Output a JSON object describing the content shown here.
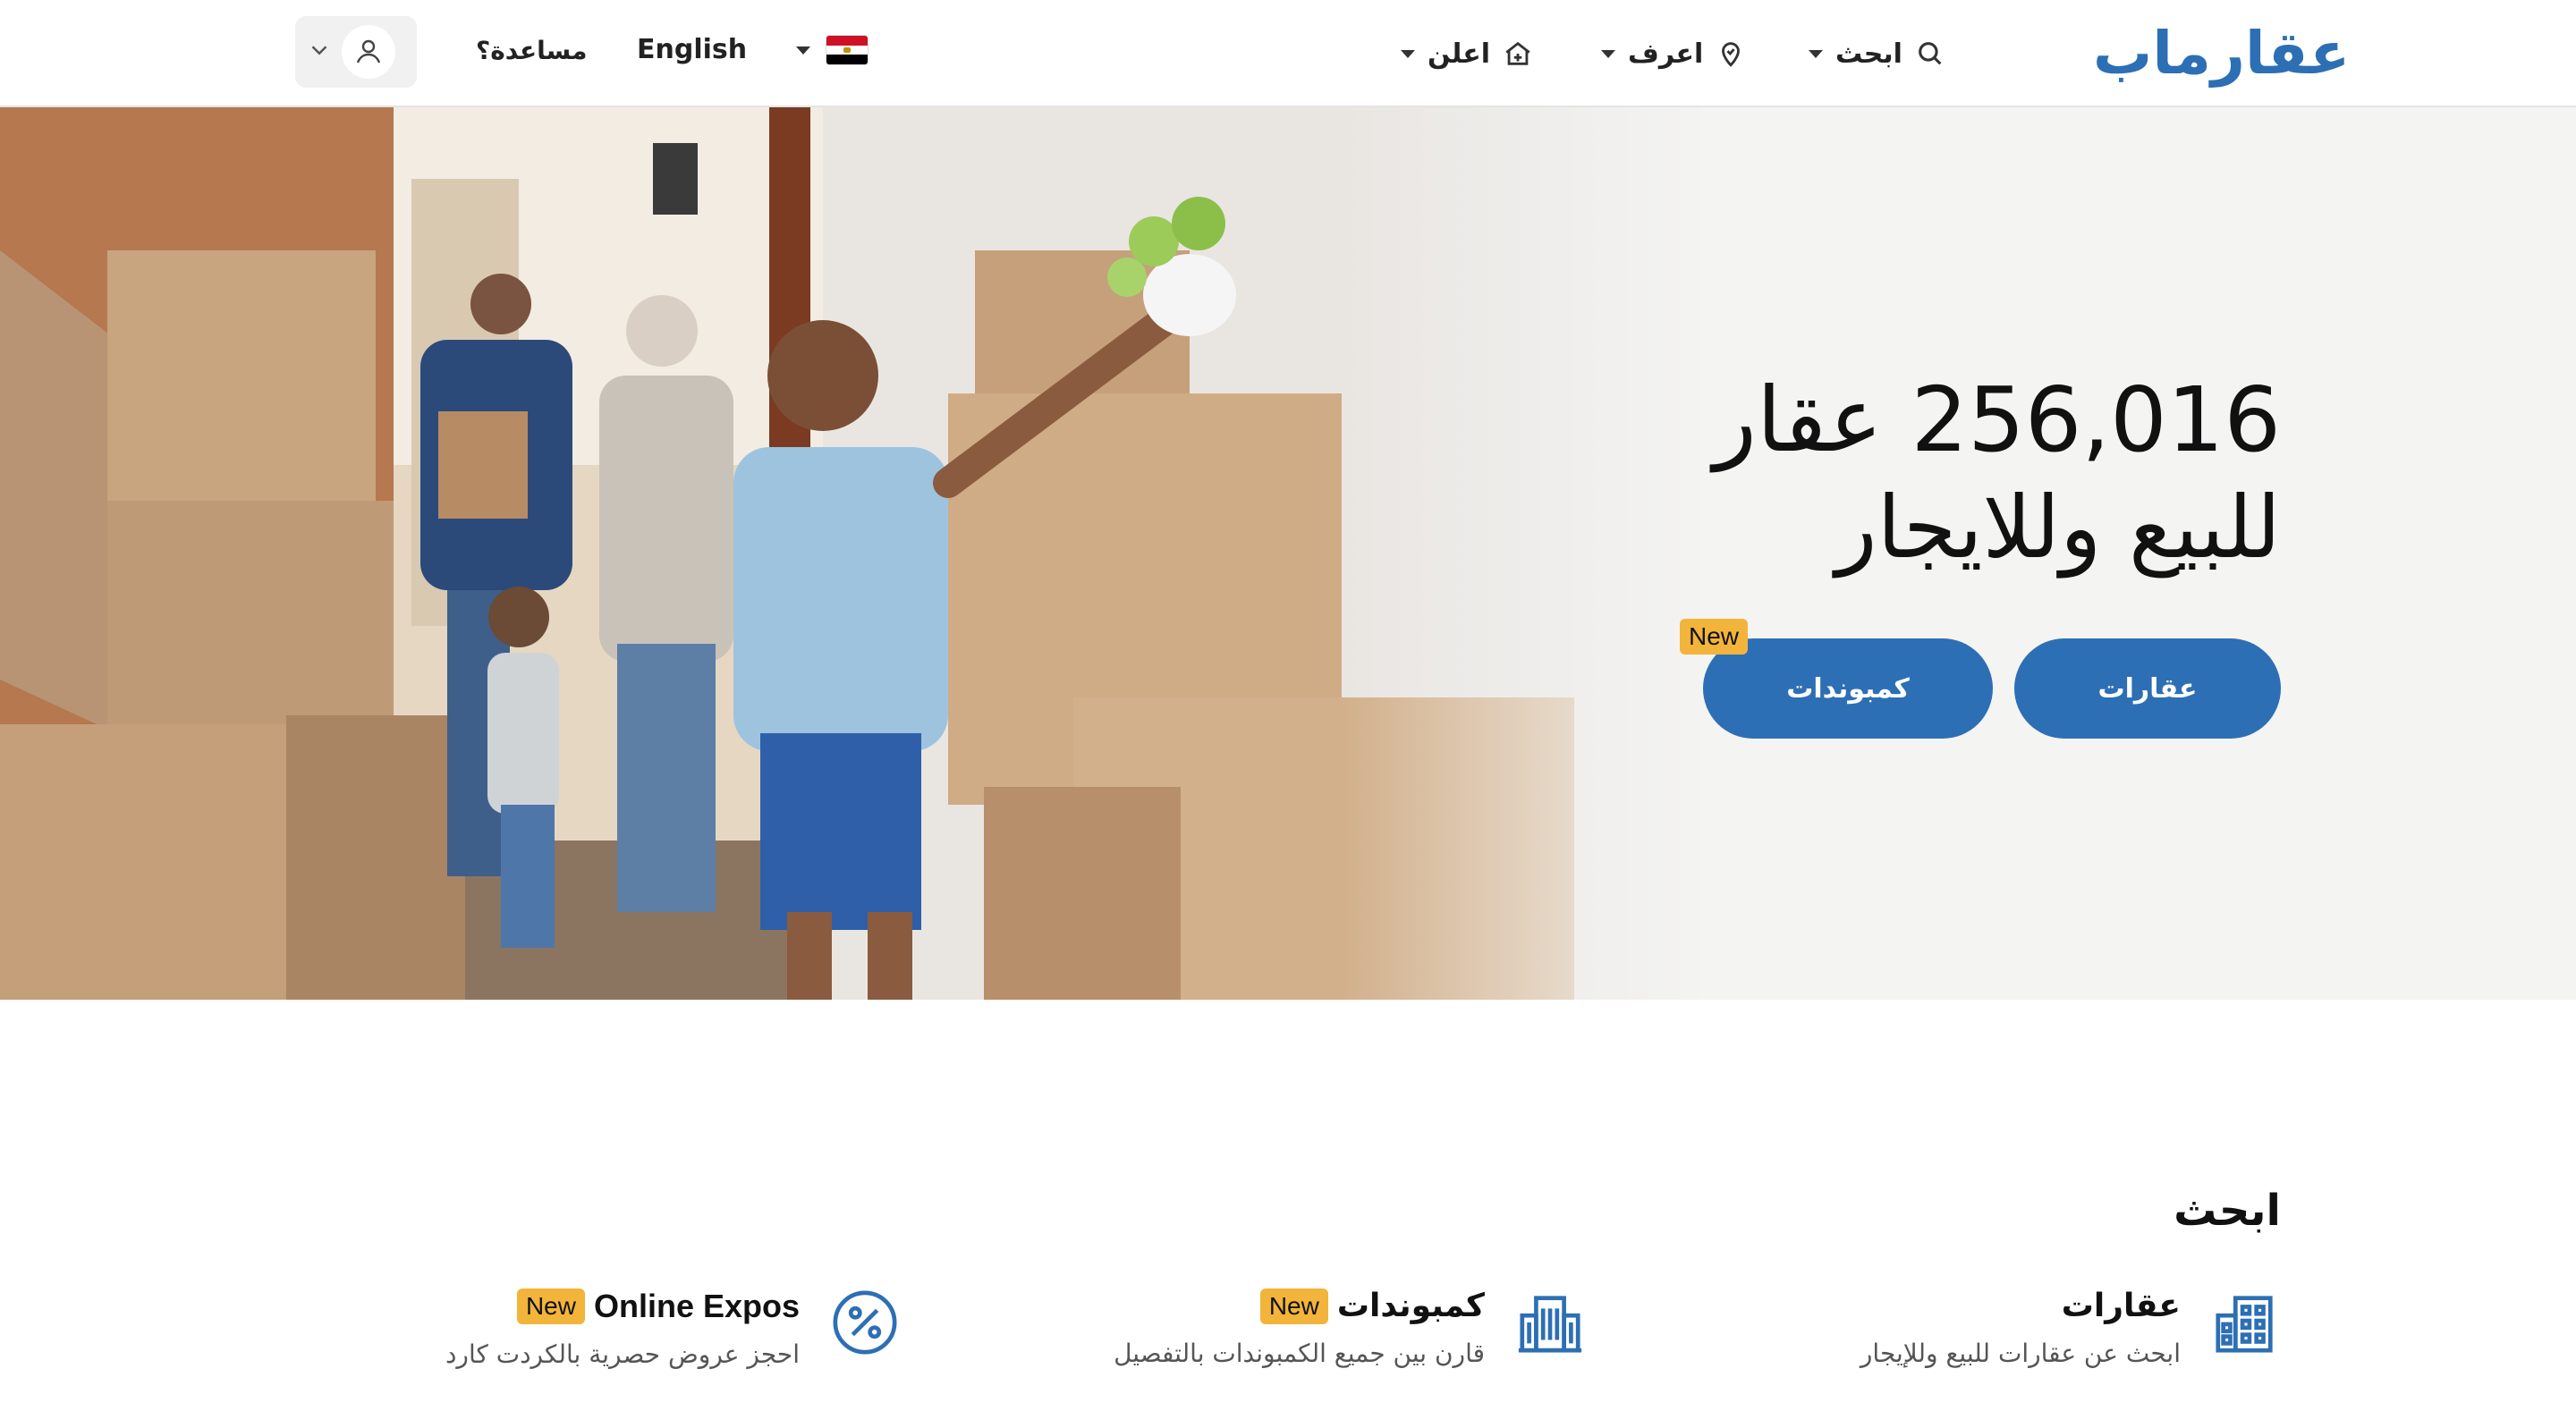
{
  "header": {
    "logo": "عقارماب",
    "nav": {
      "search": "ابحث",
      "know": "اعرف",
      "advertise": "اعلن"
    },
    "language": "English",
    "help": "مساعدة؟"
  },
  "hero": {
    "count_line": "256,016 عقار",
    "subtitle": "للبيع وللايجار",
    "btn_properties": "عقارات",
    "btn_compounds": "كمبوندات",
    "new_badge": "New"
  },
  "search_section": {
    "title": "ابحث",
    "cards": [
      {
        "title": "عقارات",
        "desc": "ابحث عن عقارات للبيع وللإيجار",
        "badge": "",
        "icon": "building-icon"
      },
      {
        "title": "كمبوندات",
        "desc": "قارن بين جميع الكمبوندات بالتفصيل",
        "badge": "New",
        "icon": "compound-icon"
      },
      {
        "title": "Online Expos",
        "desc": "احجز عروض حصرية بالكردت كارد",
        "badge": "New",
        "icon": "percent-icon"
      }
    ]
  },
  "colors": {
    "brand": "#2d6fb4",
    "badge": "#f2b43a"
  }
}
